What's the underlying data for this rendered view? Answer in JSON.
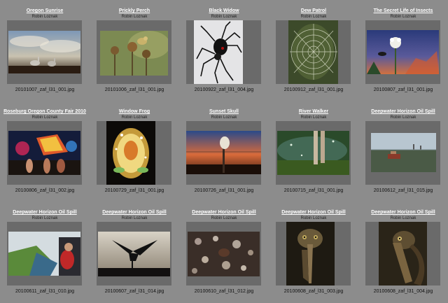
{
  "gallery": {
    "items": [
      {
        "title": "Oregon Sunrise",
        "credit": "Robin Loznak",
        "filename": "20101007_zaf_l31_001.jpg",
        "icon": "geese-sunrise-photo"
      },
      {
        "title": "Prickly Perch",
        "credit": "Robin Loznak",
        "filename": "20101006_zaf_l31_001.jpg",
        "icon": "bird-on-thistle-photo"
      },
      {
        "title": "Black Widow",
        "credit": "Robin Loznak",
        "filename": "20100922_zaf_l31_004.jpg",
        "icon": "spider-photo"
      },
      {
        "title": "Dew Patrol",
        "credit": "Robin Loznak",
        "filename": "20100912_zaf_l31_001.jpg",
        "icon": "dewy-web-photo"
      },
      {
        "title": "The Secret Life of Insects",
        "credit": "Robin Loznak",
        "filename": "20100807_zaf_l31_001.jpg",
        "icon": "insect-flower-photo"
      },
      {
        "title": "Roseburg Oregon County Fair 2010",
        "credit": "Robin Loznak",
        "filename": "20100806_zaf_l31_002.jpg",
        "icon": "fair-rides-photo"
      },
      {
        "title": "Window Frog",
        "credit": "Robin Loznak",
        "filename": "20100729_zaf_l31_001.jpg",
        "icon": "frog-photo"
      },
      {
        "title": "Sunset Skull",
        "credit": "Robin Loznak",
        "filename": "20100726_zaf_l31_001.jpg",
        "icon": "skull-sunset-photo"
      },
      {
        "title": "River Walker",
        "credit": "Robin Loznak",
        "filename": "20100715_zaf_l31_001.jpg",
        "icon": "river-legs-photo"
      },
      {
        "title": "Deepwater Horizon Oil Spill",
        "credit": "Robin Loznak",
        "filename": "20100612_zaf_l31_015.jpg",
        "icon": "oil-boat-photo"
      },
      {
        "title": "Deepwater Horizon Oil Spill",
        "credit": "Robin Loznak",
        "filename": "20100611_zaf_l31_010.jpg",
        "icon": "marsh-worker-photo"
      },
      {
        "title": "Deepwater Horizon Oil Spill",
        "credit": "Robin Loznak",
        "filename": "20100607_zaf_l31_014.jpg",
        "icon": "bird-silhouette-photo"
      },
      {
        "title": "Deepwater Horizon Oil Spill",
        "credit": "Robin Loznak",
        "filename": "20100610_zaf_l31_012.jpg",
        "icon": "oily-debris-photo"
      },
      {
        "title": "Deepwater Horizon Oil Spill",
        "credit": "Robin Loznak",
        "filename": "20100608_zaf_l31_003.jpg",
        "icon": "pelican-photo"
      },
      {
        "title": "Deepwater Horizon Oil Spill",
        "credit": "Robin Loznak",
        "filename": "20100608_zaf_l31_004.jpg",
        "icon": "oiled-pelican-photo"
      }
    ]
  }
}
